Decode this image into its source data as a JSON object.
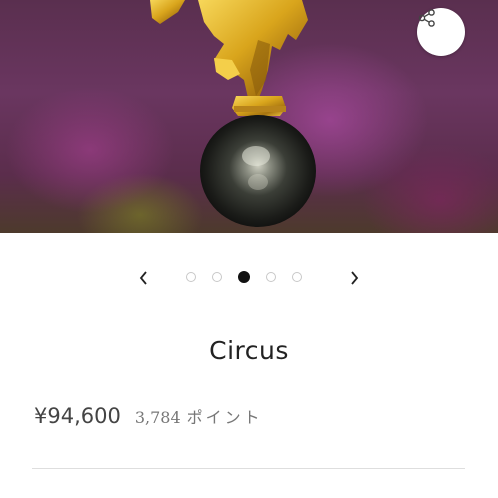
{
  "product_image": {
    "alt": "",
    "slide_count": 5,
    "active_slide_index": 2
  },
  "share_button": {
    "icon": "share-icon"
  },
  "carousel": {
    "prev_icon": "chevron-left-icon",
    "next_icon": "chevron-right-icon",
    "prev_glyph": "‹",
    "next_glyph": "›"
  },
  "product": {
    "title": "Circus",
    "price": "¥94,600",
    "points_value": "3,784",
    "points_label": "ポイント"
  },
  "colors": {
    "active_dot": "#111111",
    "inactive_dot_border": "#c8c8c8",
    "text_primary": "#222222",
    "text_secondary": "#777777"
  }
}
